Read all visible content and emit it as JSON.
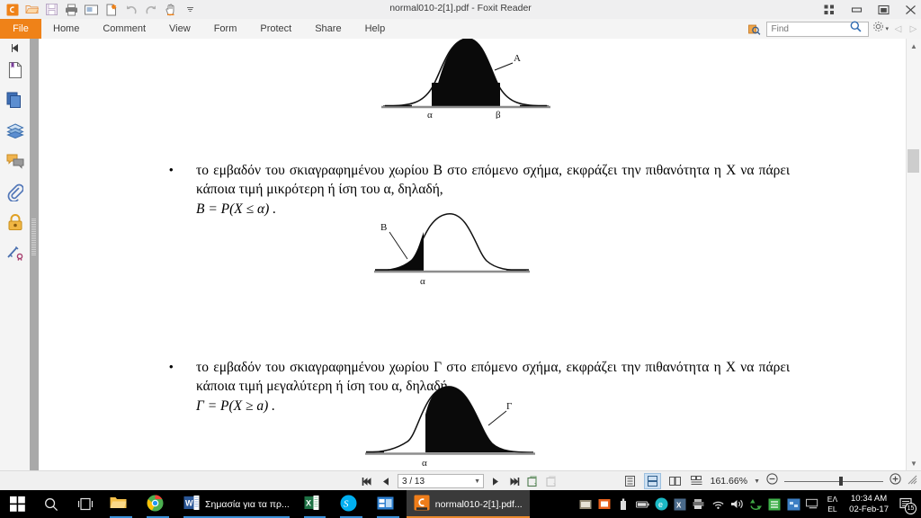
{
  "window": {
    "title": "normal010-2[1].pdf - Foxit Reader",
    "accent_color": "#ef8218",
    "quick_access": [
      {
        "name": "foxit-logo-icon",
        "label": "Foxit"
      },
      {
        "name": "open-folder-icon",
        "label": "Open"
      },
      {
        "name": "save-icon",
        "label": "Save"
      },
      {
        "name": "print-icon",
        "label": "Print"
      },
      {
        "name": "email-icon",
        "label": "Email"
      },
      {
        "name": "new-document-icon",
        "label": "Create"
      },
      {
        "name": "undo-icon",
        "label": "Undo"
      },
      {
        "name": "redo-icon",
        "label": "Redo"
      },
      {
        "name": "hand-tool-icon",
        "label": "Hand Tool"
      },
      {
        "name": "customize-caret-icon",
        "label": "Customize"
      }
    ],
    "controls": [
      {
        "name": "restore-grid-icon",
        "label": "Tile"
      },
      {
        "name": "minimize-icon",
        "label": "Minimize"
      },
      {
        "name": "maximize-icon",
        "label": "Maximize"
      },
      {
        "name": "close-icon",
        "label": "Close"
      }
    ]
  },
  "menu": {
    "file_label": "File",
    "items": [
      "Home",
      "Comment",
      "View",
      "Form",
      "Protect",
      "Share",
      "Help"
    ]
  },
  "search": {
    "placeholder": "Find",
    "value": ""
  },
  "sidebar": {
    "items": [
      {
        "name": "bookmarks-panel-icon",
        "label": "Bookmarks"
      },
      {
        "name": "pages-panel-icon",
        "label": "Page Thumbnails"
      },
      {
        "name": "layers-panel-icon",
        "label": "Layers"
      },
      {
        "name": "comments-panel-icon",
        "label": "Comments"
      },
      {
        "name": "attachments-panel-icon",
        "label": "Attachments"
      },
      {
        "name": "security-panel-icon",
        "label": "Security"
      },
      {
        "name": "signatures-panel-icon",
        "label": "Digital Signatures"
      }
    ]
  },
  "document": {
    "paragraph_b": "το εμβαδόν του σκιαγραφημένου χωρίου Β στο επόμενο σχήμα, εκφράζει την πιθανότητα η X να πάρει κάποια τιμή μικρότερη ή ίση του α, δηλαδή,",
    "formula_b": "B = P(X ≤ α) .",
    "paragraph_g": "το εμβαδόν του σκιαγραφημένου χωρίου Γ στο επόμενο σχήμα, εκφράζει την πιθανότητα η X να πάρει κάποια τιμή μεγαλύτερη ή ίση του α, δηλαδή,",
    "formula_g": "Γ = P(X ≥ a) .",
    "bullet_char": "•",
    "figures": [
      {
        "name": "figure-region-a",
        "region_label": "A",
        "tick_left": "α",
        "tick_right": "β"
      },
      {
        "name": "figure-region-b",
        "region_label": "B",
        "tick_left": "α",
        "tick_right": ""
      },
      {
        "name": "figure-region-g",
        "region_label": "Γ",
        "tick_left": "α",
        "tick_right": ""
      }
    ]
  },
  "statusbar": {
    "first_page_label": "First Page",
    "prev_page_label": "Previous Page",
    "page_value": "3 / 13",
    "next_page_label": "Next Page",
    "last_page_label": "Last Page",
    "view_modes": [
      {
        "name": "single-page-view-icon",
        "label": "Single Page",
        "active": false
      },
      {
        "name": "continuous-view-icon",
        "label": "Continuous",
        "active": true
      },
      {
        "name": "facing-view-icon",
        "label": "Facing",
        "active": false
      },
      {
        "name": "continuous-facing-view-icon",
        "label": "Continuous Facing",
        "active": false
      }
    ],
    "zoom_value": "161.66%",
    "zoom_out_label": "Zoom Out",
    "zoom_in_label": "Zoom In"
  },
  "taskbar": {
    "start_label": "Start",
    "search_label": "Search",
    "taskview_label": "Task View",
    "apps": [
      {
        "name": "taskbar-file-explorer",
        "label": "",
        "icon": "folder-icon"
      },
      {
        "name": "taskbar-chrome",
        "label": "",
        "icon": "chrome-icon"
      },
      {
        "name": "taskbar-word",
        "label": "Σημασία για τα πρ...",
        "icon": "word-icon"
      },
      {
        "name": "taskbar-excel",
        "label": "",
        "icon": "excel-icon"
      },
      {
        "name": "taskbar-skype",
        "label": "",
        "icon": "skype-icon"
      },
      {
        "name": "taskbar-store",
        "label": "",
        "icon": "store-icon"
      },
      {
        "name": "taskbar-foxit",
        "label": "normal010-2[1].pdf...",
        "icon": "foxit-icon"
      }
    ],
    "tray": {
      "language_top": "ΕΛ",
      "language_bottom": "EL",
      "time": "10:34 AM",
      "date": "02-Feb-17",
      "notification_count": "15"
    }
  }
}
